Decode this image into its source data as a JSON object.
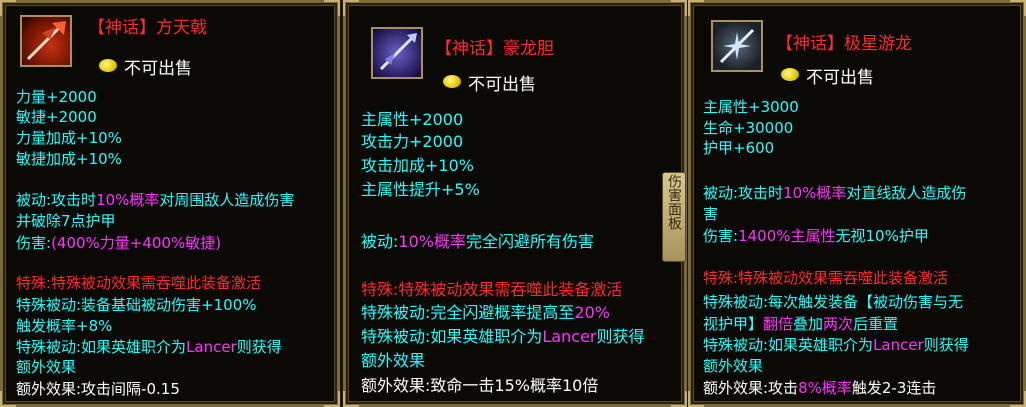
{
  "panels": [
    {
      "title": "【神话】方天戟",
      "sell": "不可出售",
      "stats": [
        "力量+2000",
        "敏捷+2000",
        "力量加成+10%",
        "敏捷加成+10%"
      ],
      "passive": {
        "prefix": "被动:攻击时",
        "rate": "10%概率",
        "text1": "对周围敌人造成伤害",
        "text2": "并破除7点护甲",
        "dmg_prefix": "伤害:",
        "dmg_value": "(400%力量+400%敏捷)"
      },
      "special_header": "特殊:特殊被动效果需吞噬此装备激活",
      "special1": "特殊被动:装备基础被动伤害+100%",
      "special2": "触发概率+8%",
      "special3_pre": "特殊被动:如果英雄职介为",
      "special3_hl": "Lancer",
      "special3_post": "则获得",
      "special4": "额外效果",
      "extra": "额外效果:攻击间隔-0.15"
    },
    {
      "title": "【神话】豪龙胆",
      "sell": "不可出售",
      "stats": [
        "主属性+2000",
        "攻击力+2000",
        "攻击加成+10%",
        "主属性提升+5%"
      ],
      "passive": {
        "prefix": "被动:",
        "rate": "10%概率",
        "text1": "完全闪避所有伤害"
      },
      "special_header": "特殊:特殊被动效果需吞噬此装备激活",
      "special1_pre": "特殊被动:完全闪避概率提高至",
      "special1_hl": "20%",
      "special3_pre": "特殊被动:如果英雄职介为",
      "special3_hl": "Lancer",
      "special3_post": "则获得",
      "special4": "额外效果",
      "extra": "额外效果:致命一击15%概率10倍"
    },
    {
      "title": "【神话】极星游龙",
      "sell": "不可出售",
      "stats": [
        "主属性+3000",
        "生命+30000",
        "护甲+600"
      ],
      "passive": {
        "prefix": "被动:攻击时",
        "rate": "10%概率",
        "text1": "对直线敌人造成伤",
        "text2": "害",
        "dmg_prefix": "伤害:",
        "dmg_value": "1400%主属性",
        "dmg_post": "无视10%护甲"
      },
      "special_header": "特殊:特殊被动效果需吞噬此装备激活",
      "special1": "特殊被动:每次触发装备【被动伤害与无",
      "special2_pre": "视护甲】",
      "special2_hl1": "翻倍",
      "special2_mid": "叠加",
      "special2_hl2": "两次",
      "special2_post": "后重置",
      "special3_pre": "特殊被动:如果英雄职介为",
      "special3_hl": "Lancer",
      "special3_post": "则获得",
      "special4": "额外效果",
      "extra_pre": "额外效果:攻击",
      "extra_hl": "8%概率",
      "extra_post": "触发2-3连击"
    }
  ],
  "side_tab": "伤害面板"
}
